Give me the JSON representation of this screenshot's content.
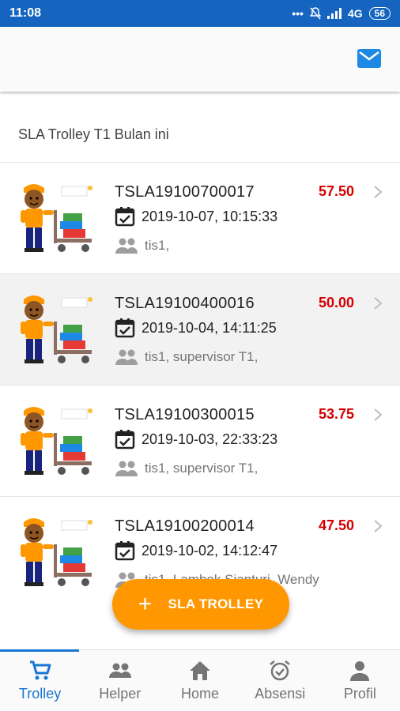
{
  "status_bar": {
    "time": "11:08",
    "network": "4G",
    "battery": "56"
  },
  "section": {
    "title": "SLA Trolley T1 Bulan ini"
  },
  "records": [
    {
      "code": "TSLA19100700017",
      "score": "57.50",
      "datetime": "2019-10-07, 10:15:33",
      "people": "tis1,"
    },
    {
      "code": "TSLA19100400016",
      "score": "50.00",
      "datetime": "2019-10-04, 14:11:25",
      "people": "tis1, supervisor T1,"
    },
    {
      "code": "TSLA19100300015",
      "score": "53.75",
      "datetime": "2019-10-03, 22:33:23",
      "people": "tis1, supervisor T1,"
    },
    {
      "code": "TSLA19100200014",
      "score": "47.50",
      "datetime": "2019-10-02, 14:12:47",
      "people": "tis1, Lambok Sianturi, Wendy"
    }
  ],
  "fab": {
    "label": "SLA TROLLEY",
    "icon": "plus-icon"
  },
  "bottom_nav": [
    {
      "label": "Trolley",
      "icon": "cart-icon",
      "active": true
    },
    {
      "label": "Helper",
      "icon": "people-icon"
    },
    {
      "label": "Home",
      "icon": "home-icon"
    },
    {
      "label": "Absensi",
      "icon": "alarm-icon"
    },
    {
      "label": "Profil",
      "icon": "person-icon"
    }
  ],
  "colors": {
    "primary": "#1565c0",
    "accent": "#ff9800",
    "score": "#d50000"
  }
}
